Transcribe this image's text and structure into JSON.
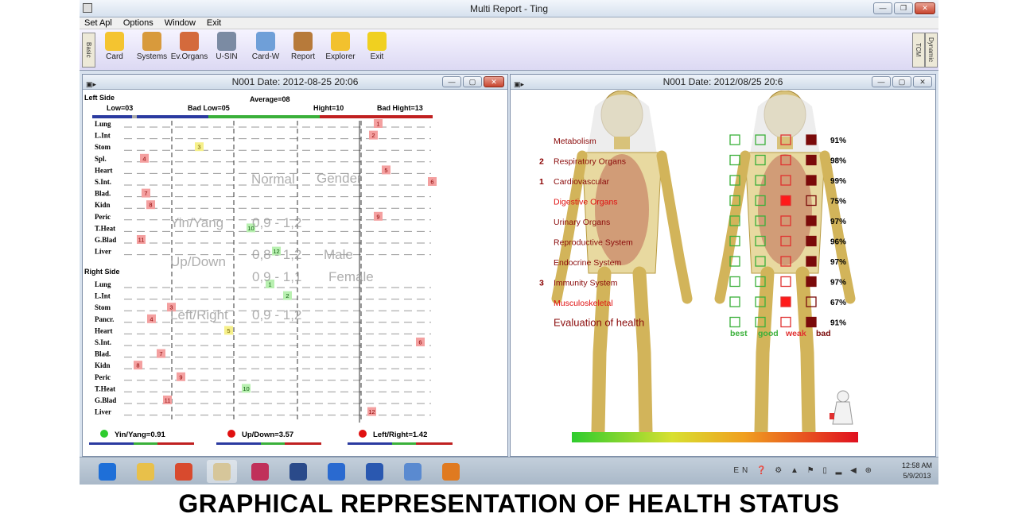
{
  "window": {
    "title": "Multi Report  - Ting"
  },
  "menu": [
    "Set Apl",
    "Options",
    "Window",
    "Exit"
  ],
  "toolbar": {
    "left_tab": "Basic",
    "right_tabs": [
      "TCM",
      "Dynamic"
    ],
    "buttons": [
      {
        "label": "Card",
        "icon": "card-icon",
        "color": "#f4c430"
      },
      {
        "label": "Systems",
        "icon": "body-figures-icon",
        "color": "#d89a3c"
      },
      {
        "label": "Ev.Organs",
        "icon": "organs-icon",
        "color": "#d46a3c"
      },
      {
        "label": "U-SIN",
        "icon": "network-icon",
        "color": "#7b8ba3"
      },
      {
        "label": "Card-W",
        "icon": "card-w-icon",
        "color": "#6f9fd8"
      },
      {
        "label": "Report",
        "icon": "pencils-icon",
        "color": "#b77a3a"
      },
      {
        "label": "Explorer",
        "icon": "explorer-icon",
        "color": "#f2c12e"
      },
      {
        "label": "Exit",
        "icon": "exit-icon",
        "color": "#f0d020"
      }
    ]
  },
  "left_window": {
    "title": "N001 Date: 2012-08-25 20:06",
    "left_side_title": "Left Side",
    "right_side_title": "Right Side",
    "scale_labels": {
      "low": "Low=03",
      "bad_low": "Bad Low=05",
      "average": "Average=08",
      "hight": "Hight=10",
      "bad_hight": "Bad Hight=13"
    },
    "overlay_labels": [
      "Normal",
      "Gender",
      "Yin/Yang",
      "0,9 - 1,2",
      "Up/Down",
      "0,8 - 1,2",
      "Male",
      "0,9 - 1,1",
      "Female",
      "Left/Right",
      "0,9 - 1,2"
    ],
    "left_organs": [
      {
        "name": "Lung",
        "value": 1,
        "level": "bad"
      },
      {
        "name": "L.Int",
        "value": 2,
        "level": "bad"
      },
      {
        "name": "Stom",
        "value": 3,
        "level": "warn"
      },
      {
        "name": "Spl.",
        "value": 4,
        "level": "bad"
      },
      {
        "name": "Heart",
        "value": 5,
        "level": "bad"
      },
      {
        "name": "S.Int.",
        "value": 6,
        "level": "bad"
      },
      {
        "name": "Blad.",
        "value": 7,
        "level": "bad"
      },
      {
        "name": "Kidn",
        "value": 8,
        "level": "bad"
      },
      {
        "name": "Peric",
        "value": 9,
        "level": "bad"
      },
      {
        "name": "T.Heat",
        "value": 10,
        "level": "good"
      },
      {
        "name": "G.Blad",
        "value": 11,
        "level": "bad"
      },
      {
        "name": "Liver",
        "value": 12,
        "level": "good"
      }
    ],
    "right_organs": [
      {
        "name": "Lung",
        "value": 1,
        "level": "good"
      },
      {
        "name": "L.Int",
        "value": 2,
        "level": "good"
      },
      {
        "name": "Stom",
        "value": 3,
        "level": "bad"
      },
      {
        "name": "Pancr.",
        "value": 4,
        "level": "bad"
      },
      {
        "name": "Heart",
        "value": 5,
        "level": "warn"
      },
      {
        "name": "S.Int.",
        "value": 6,
        "level": "bad"
      },
      {
        "name": "Blad.",
        "value": 7,
        "level": "bad"
      },
      {
        "name": "Kidn",
        "value": 8,
        "level": "bad"
      },
      {
        "name": "Peric",
        "value": 9,
        "level": "bad"
      },
      {
        "name": "T.Heat",
        "value": 10,
        "level": "good"
      },
      {
        "name": "G.Blad",
        "value": 11,
        "level": "bad"
      },
      {
        "name": "Liver",
        "value": 12,
        "level": "bad"
      }
    ],
    "ratios": [
      {
        "label": "Yin/Yang=0.91",
        "status_color": "#2ecc2e"
      },
      {
        "label": "Up/Down=3.57",
        "status_color": "#e01010"
      },
      {
        "label": "Left/Right=1.42",
        "status_color": "#e01010"
      }
    ]
  },
  "right_window": {
    "title": "N001 Date: 2012/08/25 20:6",
    "systems": [
      {
        "num": "",
        "name": "Metabolism",
        "pct": "91%",
        "state": "bad",
        "highlight": false
      },
      {
        "num": "2",
        "name": "Respiratory Organs",
        "pct": "98%",
        "state": "bad",
        "highlight": false
      },
      {
        "num": "1",
        "name": "Cardiovascular",
        "pct": "99%",
        "state": "bad",
        "highlight": false
      },
      {
        "num": "",
        "name": "Digestive Organs",
        "pct": "75%",
        "state": "weak",
        "highlight": true
      },
      {
        "num": "",
        "name": "Urinary Organs",
        "pct": "97%",
        "state": "bad",
        "highlight": false
      },
      {
        "num": "",
        "name": "Reproductive System",
        "pct": "96%",
        "state": "bad",
        "highlight": false
      },
      {
        "num": "",
        "name": "Endocrine System",
        "pct": "97%",
        "state": "bad",
        "highlight": false
      },
      {
        "num": "3",
        "name": "Immunity System",
        "pct": "97%",
        "state": "bad",
        "highlight": false
      },
      {
        "num": "",
        "name": "Musculoskeletal",
        "pct": "67%",
        "state": "weak",
        "highlight": true
      },
      {
        "num": "",
        "name": "Evaluation of health",
        "pct": "91%",
        "state": "bad",
        "highlight": false
      }
    ],
    "legend": [
      "best",
      "good",
      "weak",
      "bad"
    ]
  },
  "taskbar": {
    "apps": [
      "ie-icon",
      "folder-icon",
      "chrome-icon",
      "report-app-icon",
      "access-icon",
      "remote-icon",
      "network-icon",
      "word-icon",
      "control-panel-icon",
      "help-icon"
    ],
    "lang": "EN",
    "time": "12:58 AM",
    "date": "5/9/2013"
  },
  "caption": "GRAPHICAL REPRESENTATION OF HEALTH STATUS"
}
